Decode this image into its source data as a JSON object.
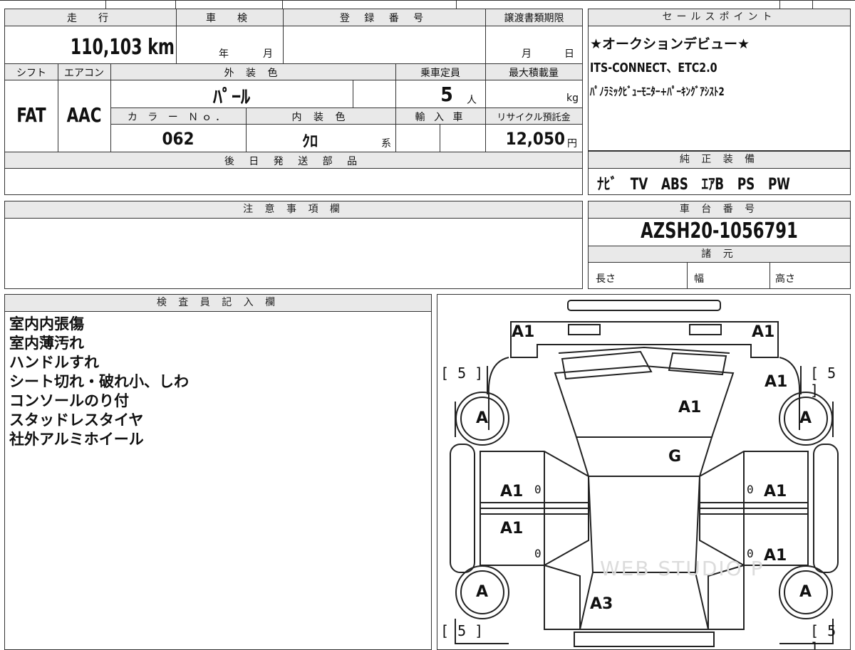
{
  "top_sheet": {
    "mileage_label": "走　行",
    "mileage_value": "110,103 km",
    "inspection_label": "車　検",
    "inspection_year_unit": "年",
    "inspection_month_unit": "月",
    "registration_label": "登 録 番 号",
    "registration_value": "",
    "transfer_deadline_label": "譲渡書類期限",
    "transfer_month_unit": "月",
    "transfer_day_unit": "日",
    "shift_label": "シフト",
    "shift_value": "FAT",
    "aircon_label": "エアコン",
    "aircon_value": "AAC",
    "exterior_color_label": "外 装 色",
    "exterior_color_value": "ﾊﾟｰﾙ",
    "capacity_label": "乗車定員",
    "capacity_value": "5",
    "capacity_unit": "人",
    "max_load_label": "最大積載量",
    "max_load_unit": "kg",
    "color_no_label": "カ ラ ー Ｎｏ．",
    "color_no_value": "062",
    "interior_color_label": "内 装 色",
    "interior_color_value": "ｸﾛ",
    "interior_color_suffix": "系",
    "import_label": "輸 入 車",
    "recycle_label": "リサイクル預託金",
    "recycle_value": "12,050",
    "recycle_unit": "円",
    "later_parts_label": "後 日 発 送 部 品",
    "later_parts_value": ""
  },
  "sales_points": {
    "label": "セールスポイント",
    "lines": [
      "★オークションデビュー★",
      "ITS-CONNECT、ETC2.0",
      "ﾊﾟﾉﾗﾐｯｸﾋﾞｭｰﾓﾆﾀｰ+ﾊﾟｰｷﾝｸﾞｱｼｽﾄ2"
    ]
  },
  "genuine_equipment": {
    "label": "純 正 装 備",
    "value": "ﾅﾋﾞ　TV　ABS　ｴｱB　PS　PW"
  },
  "notes": {
    "label": "注 意 事 項 欄",
    "value": ""
  },
  "chassis": {
    "label": "車 台 番 号",
    "value": "AZSH20-1056791",
    "specs_label": "諸 元",
    "length_label": "長さ",
    "width_label": "幅",
    "height_label": "高さ"
  },
  "inspector": {
    "label": "検 査 員 記 入 欄",
    "lines": [
      "室内内張傷",
      "室内薄汚れ",
      "ハンドルすれ",
      "シート切れ・破れ小、しわ",
      "コンソールのり付",
      "スタッドレスタイヤ",
      "社外アルミホイール"
    ]
  },
  "diagram": {
    "marks": {
      "front_left_corner": "A1",
      "front_right_corner": "A1",
      "tire_fl_depth": "[ 5 ]",
      "tire_fr_depth": "[ 5 ]",
      "tire_rl_depth": "[ 5 ]",
      "tire_rr_depth": "[ 5 ]",
      "right_fender": "A1",
      "hood": "A1",
      "windshield": "G",
      "wheel_fl": "A",
      "wheel_fr": "A",
      "wheel_rl": "A",
      "wheel_rr": "A",
      "left_front_door": "A1",
      "left_rear_door": "A1",
      "right_front_door": "A1",
      "right_rear_door": "A1",
      "door_num_lf": "0",
      "door_num_lr": "0",
      "door_num_rf": "0",
      "door_num_rr": "0",
      "roof_rear": "A3"
    },
    "watermark": "WEB STUDIO P"
  }
}
